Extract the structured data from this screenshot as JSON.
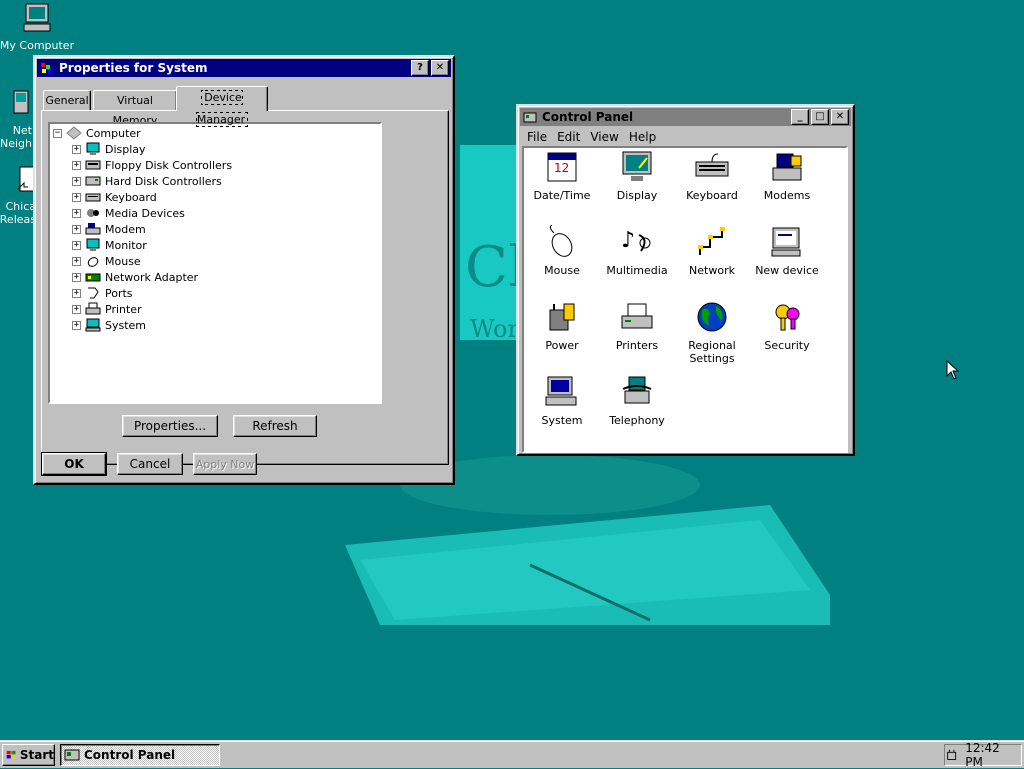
{
  "wallpaper": {
    "big_text": "Ch",
    "small_text": "Wor"
  },
  "desktop_icons": [
    {
      "label": "My Computer",
      "icon": "computer-icon"
    },
    {
      "label": "Net\nNeigh",
      "icon": "network-neighborhood-icon"
    },
    {
      "label": "Chica\nReleas",
      "icon": "shortcut-icon"
    }
  ],
  "system_props": {
    "title": "Properties for System",
    "help_button": "?",
    "close_button": "✕",
    "tabs": [
      "General",
      "Virtual Memory",
      "Device Manager"
    ],
    "selected_tab": "Device Manager",
    "tree": {
      "root": "Computer",
      "items": [
        "Display",
        "Floppy Disk Controllers",
        "Hard Disk Controllers",
        "Keyboard",
        "Media Devices",
        "Modem",
        "Monitor",
        "Mouse",
        "Network Adapter",
        "Ports",
        "Printer",
        "System"
      ]
    },
    "properties_button": "Properties...",
    "refresh_button": "Refresh",
    "ok_button": "OK",
    "cancel_button": "Cancel",
    "apply_button": "Apply Now"
  },
  "control_panel": {
    "title": "Control Panel",
    "menu": [
      "File",
      "Edit",
      "View",
      "Help"
    ],
    "items": [
      {
        "label": "Date/Time",
        "icon": "date-time-icon"
      },
      {
        "label": "Display",
        "icon": "display-icon"
      },
      {
        "label": "Keyboard",
        "icon": "keyboard-icon"
      },
      {
        "label": "Modems",
        "icon": "modems-icon"
      },
      {
        "label": "Mouse",
        "icon": "mouse-icon"
      },
      {
        "label": "Multimedia",
        "icon": "multimedia-icon"
      },
      {
        "label": "Network",
        "icon": "network-icon"
      },
      {
        "label": "New device",
        "icon": "new-device-icon"
      },
      {
        "label": "Power",
        "icon": "power-icon"
      },
      {
        "label": "Printers",
        "icon": "printers-icon"
      },
      {
        "label": "Regional\nSettings",
        "icon": "globe-icon"
      },
      {
        "label": "Security",
        "icon": "keys-icon"
      },
      {
        "label": "System",
        "icon": "system-icon"
      },
      {
        "label": "Telephony",
        "icon": "telephony-icon"
      }
    ]
  },
  "taskbar": {
    "start_label": "Start",
    "tasks": [
      "Control Panel"
    ],
    "clock": "12:42 PM"
  },
  "colors": {
    "desktop": "#008080",
    "active_title": "#000080",
    "inactive_title": "#808080",
    "face": "#c0c0c0"
  }
}
